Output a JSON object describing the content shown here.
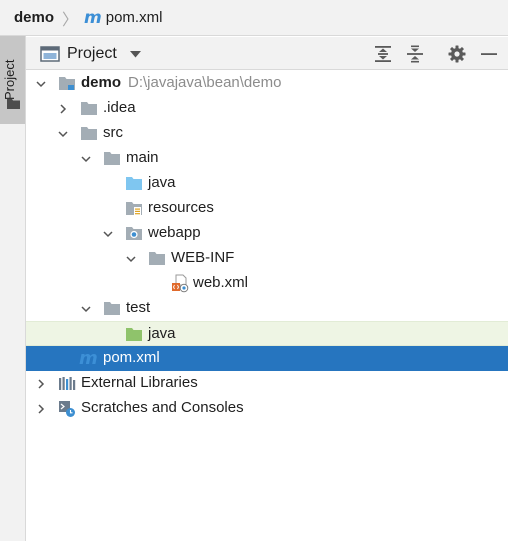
{
  "breadcrumb": {
    "project": "demo",
    "file": "pom.xml",
    "file_icon": "m"
  },
  "stripe": {
    "tab_label": "Project"
  },
  "panel": {
    "title": "Project"
  },
  "tree": {
    "demo": {
      "label": "demo",
      "path": "D:\\javajava\\bean\\demo"
    },
    "idea": "idea",
    "idea_prefix": ".",
    "src": "src",
    "main": "main",
    "java_main": "java",
    "resources": "resources",
    "webapp": "webapp",
    "webinf": "WEB-INF",
    "webxml": "web.xml",
    "test": "test",
    "java_test": "java",
    "pom": "pom.xml",
    "pom_icon": "m",
    "ext_libs": "External Libraries",
    "scratches": "Scratches and Consoles"
  },
  "colors": {
    "selection": "#2675bf",
    "highlight": "#eef5e4",
    "folder": "#a3adb5",
    "source_folder": "#7fc6f0",
    "test_folder": "#8fc36b"
  }
}
